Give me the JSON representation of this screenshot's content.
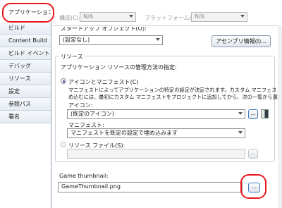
{
  "nav": {
    "items": [
      "アプリケーション",
      "ビルド",
      "Content Build",
      "ビルド イベント",
      "デバッグ",
      "リソース",
      "設定",
      "参照パス",
      "署名"
    ],
    "active_index": 0
  },
  "top": {
    "config_label": "構成(C):",
    "config_value": "N/A",
    "platform_label": "プラットフォーム(M):",
    "platform_value": "N/A",
    "startup_label": "スタートアップ オブジェクト(O):",
    "startup_value": "(設定なし)",
    "assembly_button": "アセンブリ情報(I)..."
  },
  "resources": {
    "section_label": "リソース",
    "description": "アプリケーション リソースの管理方法の指定:",
    "option1_label": "アイコンとマニフェスト(C)",
    "option1_desc_line1": "マニフェストによってアプリケーションの特定の設定が決定されます。カスタム マニフェストを埋",
    "option1_desc_line2": "め込むには、最初にカスタム マニフェストをプロジェクトに追加してから、次の一覧から選択しま",
    "icon_label": "アイコン:",
    "icon_value": "(既定のアイコン)",
    "icon_browse": "...",
    "manifest_label": "マニフェスト:",
    "manifest_value": "マニフェストを既定の設定で埋め込みます",
    "option2_label": "リソース ファイル(S):",
    "option2_browse": "..."
  },
  "thumbnail": {
    "label": "Game thumbnail:",
    "value": "GameThumbnail.png",
    "browse": "..."
  },
  "colors": {
    "highlight": "#e8151b",
    "border": "#8fa3b8"
  }
}
